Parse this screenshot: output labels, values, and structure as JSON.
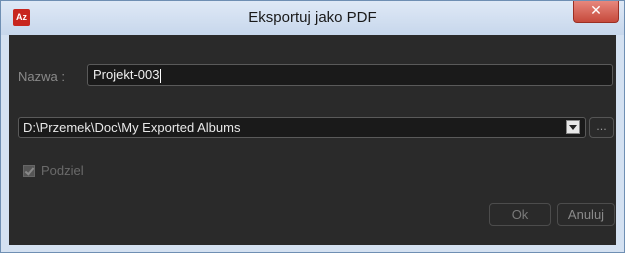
{
  "window": {
    "title": "Eksportuj jako PDF",
    "app_icon_text": "Az",
    "close_glyph": "✕"
  },
  "form": {
    "name_label": "Nazwa :",
    "name_value": "Projekt-003",
    "path_value": "D:\\Przemek\\Doc\\My Exported Albums",
    "browse_label": "...",
    "split_label": "Podziel",
    "split_checked": true,
    "split_enabled": false
  },
  "buttons": {
    "ok_label": "Ok",
    "cancel_label": "Anuluj"
  }
}
